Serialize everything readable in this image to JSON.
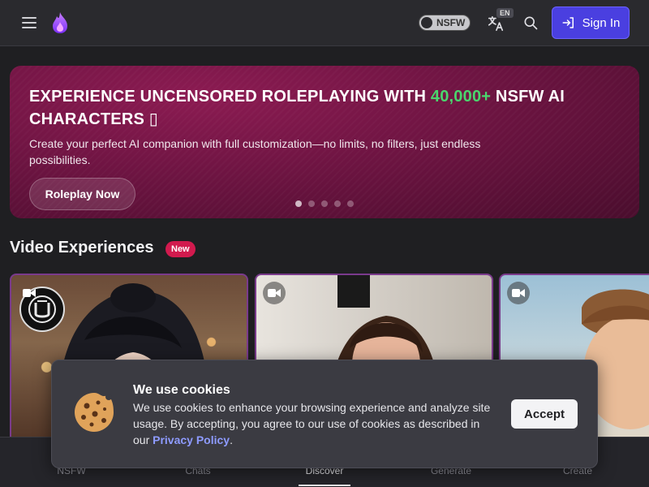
{
  "header": {
    "nsfw_label": "NSFW",
    "lang_badge": "EN",
    "signin_label": "Sign In",
    "brand_color": "#4a3fe0"
  },
  "hero": {
    "title_part1": "EXPERIENCE UNCENSORED ROLEPLAYING WITH ",
    "title_accent": "40,000+",
    "title_part2": " NSFW AI CHARACTERS ▯",
    "subtitle": "Create your perfect AI companion with full customization—no limits, no filters, just endless possibilities.",
    "button_label": "Roleplay Now",
    "slide_count": 5,
    "active_slide": 1,
    "accent_color": "#4ad66d"
  },
  "section": {
    "title": "Video Experiences",
    "badge": "New"
  },
  "cards": [
    {
      "type": "video",
      "icon": "video-camera-icon"
    },
    {
      "type": "video",
      "icon": "video-camera-icon"
    },
    {
      "type": "video",
      "icon": "video-camera-icon"
    }
  ],
  "cookie": {
    "title": "We use cookies",
    "text": "We use cookies to enhance your browsing experience and analyze site usage. By accepting, you agree to our use of cookies as described in our ",
    "link_text": "Privacy Policy",
    "text_end": ".",
    "accept_label": "Accept"
  },
  "bottom_nav": {
    "items": [
      {
        "label": "NSFW",
        "active": false
      },
      {
        "label": "Chats",
        "active": false
      },
      {
        "label": "Discover",
        "active": true
      },
      {
        "label": "Generate",
        "active": false
      },
      {
        "label": "Create",
        "active": false
      }
    ]
  }
}
